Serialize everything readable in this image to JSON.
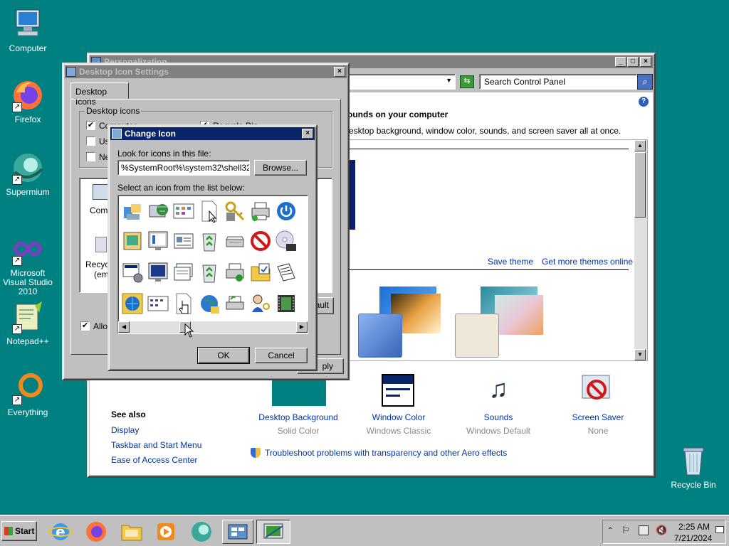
{
  "desktop": {
    "icons": [
      {
        "label": "Computer"
      },
      {
        "label": "Firefox"
      },
      {
        "label": "Supermium"
      },
      {
        "label": "Microsoft Visual Studio 2010"
      },
      {
        "label": "Notepad++"
      },
      {
        "label": "Everything"
      },
      {
        "label": "Recycle Bin"
      }
    ]
  },
  "personalization": {
    "title": "Personalization",
    "address_text": "n",
    "search_placeholder": "Search Control Panel",
    "heading": "ounds on your computer",
    "subheading": "esktop background, window color, sounds, and screen saver all at once.",
    "save_theme": "Save theme",
    "get_more": "Get more themes online",
    "see_also_title": "See also",
    "see_also": [
      "Display",
      "Taskbar and Start Menu",
      "Ease of Access Center"
    ],
    "bottom_items": [
      {
        "label": "Desktop Background",
        "value": "Solid Color"
      },
      {
        "label": "Window Color",
        "value": "Windows Classic"
      },
      {
        "label": "Sounds",
        "value": "Windows Default"
      },
      {
        "label": "Screen Saver",
        "value": "None"
      }
    ],
    "troubleshoot": "Troubleshoot problems with transparency and other Aero effects"
  },
  "desktop_icon_settings": {
    "title": "Desktop Icon Settings",
    "tab": "Desktop Icons",
    "group_title": "Desktop icons",
    "checkboxes": [
      {
        "label": "Computer",
        "checked": true
      },
      {
        "label": "Recycle Bin",
        "checked": true
      },
      {
        "label": "Us",
        "checked": false
      },
      {
        "label": "Ne",
        "checked": false
      }
    ],
    "preview_items": [
      "Comp",
      "Recyc",
      "(emp"
    ],
    "restore_default": "ault",
    "allow_label": "Allow",
    "apply": "ply"
  },
  "change_icon": {
    "title": "Change Icon",
    "look_label": "Look for icons in this file:",
    "file_path": "%SystemRoot%\\system32\\shell32.dll",
    "browse": "Browse...",
    "select_label": "Select an icon from the list below:",
    "ok": "OK",
    "cancel": "Cancel"
  },
  "taskbar": {
    "start": "Start",
    "time": "2:25 AM",
    "date": "7/21/2024"
  },
  "colors": {
    "desktop": "#008080",
    "active_title": "#0a246a",
    "inactive_title": "#808080",
    "link": "#0033aa"
  }
}
